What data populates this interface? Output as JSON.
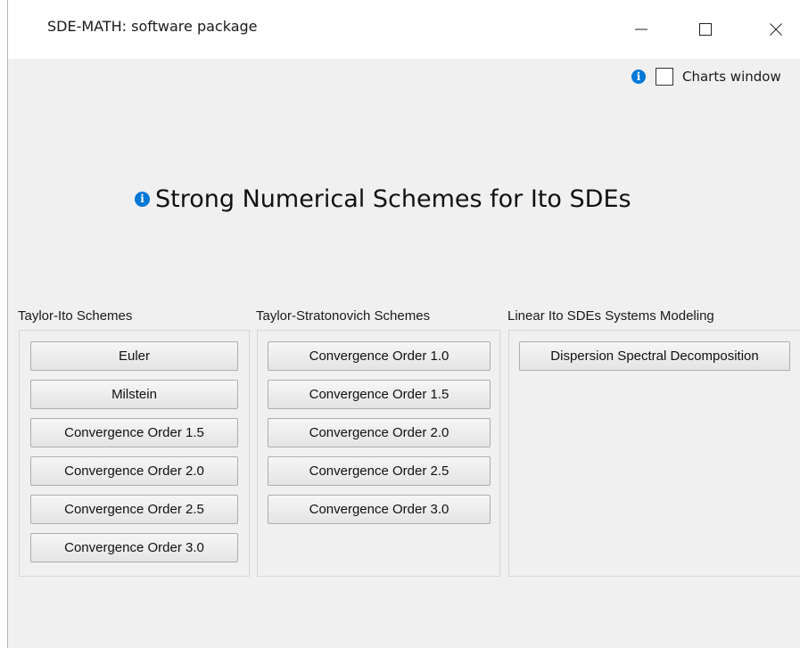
{
  "window": {
    "title": "SDE-MATH: software package",
    "min_glyph": "—",
    "close_glyph": "✕"
  },
  "info_icon_glyph": "i",
  "charts_window": {
    "label": "Charts window",
    "checked": false
  },
  "heading": "Strong Numerical Schemes for Ito SDEs",
  "groups": [
    {
      "label": "Taylor-Ito Schemes",
      "buttons": [
        "Euler",
        "Milstein",
        "Convergence Order 1.5",
        "Convergence Order 2.0",
        "Convergence Order 2.5",
        "Convergence Order 3.0"
      ]
    },
    {
      "label": "Taylor-Stratonovich Schemes",
      "buttons": [
        "Convergence Order 1.0",
        "Convergence Order 1.5",
        "Convergence Order 2.0",
        "Convergence Order 2.5",
        "Convergence Order 3.0"
      ]
    },
    {
      "label": "Linear Ito SDEs Systems Modeling",
      "buttons": [
        "Dispersion Spectral Decomposition"
      ]
    }
  ],
  "colors": {
    "info_accent": "#0078d7",
    "window_bg": "#f0f0f0",
    "titlebar_bg": "#ffffff"
  }
}
